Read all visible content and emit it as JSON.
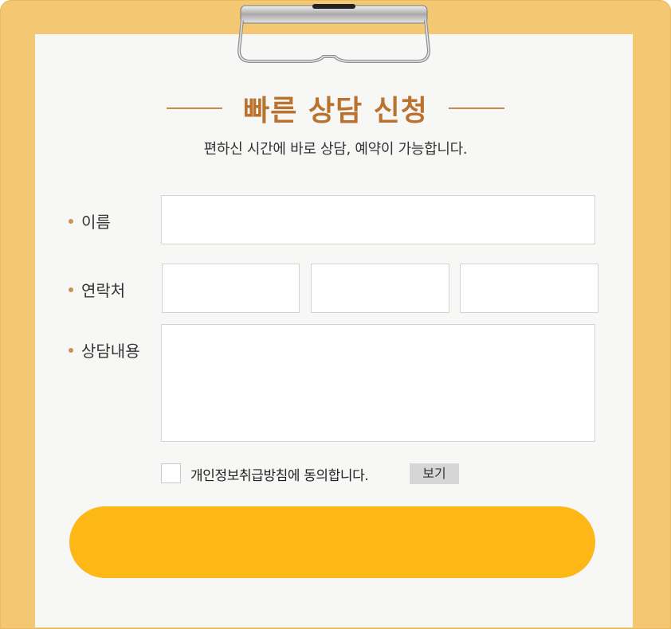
{
  "form": {
    "title": "빠른 상담 신청",
    "subtitle": "편하신 시간에 바로 상담, 예약이 가능합니다.",
    "fields": {
      "name_label": "이름",
      "name_value": "",
      "phone_label": "연락처",
      "phone_1": "",
      "phone_2": "",
      "phone_3": "",
      "message_label": "상담내용",
      "message_value": ""
    },
    "privacy": {
      "agree_text": "개인정보취급방침에 동의합니다.",
      "view_label": "보기",
      "checked": false
    },
    "submit_label": ""
  },
  "colors": {
    "board": "#f4c873",
    "sheet": "#f7f7f6",
    "title": "#b9732f",
    "bullet": "#c9924f",
    "submit": "#fdb817"
  },
  "icons": {
    "clip": "clipboard-clip-icon"
  }
}
